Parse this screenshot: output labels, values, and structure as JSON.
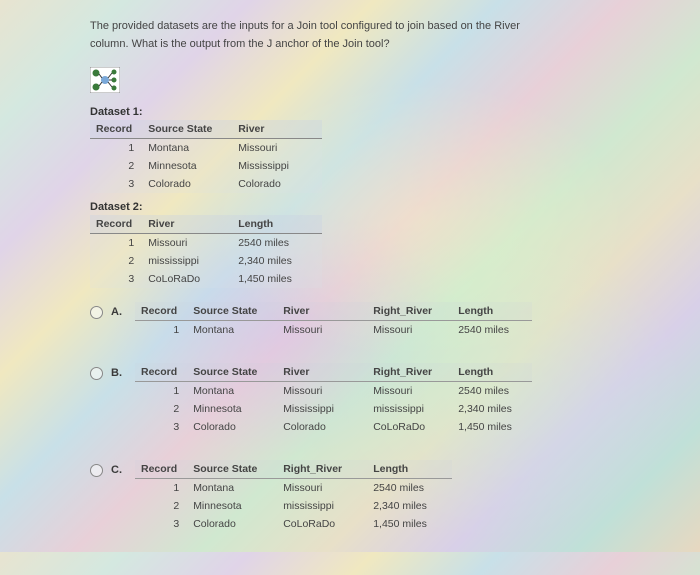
{
  "question": {
    "line1": "The provided datasets are the inputs for a Join tool configured to join based on the River",
    "line2": "column. What is the output from the J anchor of the Join tool?"
  },
  "dataset1": {
    "label": "Dataset 1:",
    "headers": {
      "h0": "Record",
      "h1": "Source State",
      "h2": "River"
    },
    "rows": [
      {
        "r": "1",
        "c1": "Montana",
        "c2": "Missouri"
      },
      {
        "r": "2",
        "c1": "Minnesota",
        "c2": "Mississippi"
      },
      {
        "r": "3",
        "c1": "Colorado",
        "c2": "Colorado"
      }
    ]
  },
  "dataset2": {
    "label": "Dataset 2:",
    "headers": {
      "h0": "Record",
      "h1": "River",
      "h2": "Length"
    },
    "rows": [
      {
        "r": "1",
        "c1": "Missouri",
        "c2": "2540 miles"
      },
      {
        "r": "2",
        "c1": "mississippi",
        "c2": "2,340 miles"
      },
      {
        "r": "3",
        "c1": "CoLoRaDo",
        "c2": "1,450 miles"
      }
    ]
  },
  "options": {
    "a": {
      "label": "A.",
      "headers": {
        "h0": "Record",
        "h1": "Source State",
        "h2": "River",
        "h3": "Right_River",
        "h4": "Length"
      },
      "rows": [
        {
          "r": "1",
          "c1": "Montana",
          "c2": "Missouri",
          "c3": "Missouri",
          "c4": "2540 miles"
        }
      ]
    },
    "b": {
      "label": "B.",
      "headers": {
        "h0": "Record",
        "h1": "Source State",
        "h2": "River",
        "h3": "Right_River",
        "h4": "Length"
      },
      "rows": [
        {
          "r": "1",
          "c1": "Montana",
          "c2": "Missouri",
          "c3": "Missouri",
          "c4": "2540 miles"
        },
        {
          "r": "2",
          "c1": "Minnesota",
          "c2": "Mississippi",
          "c3": "mississippi",
          "c4": "2,340 miles"
        },
        {
          "r": "3",
          "c1": "Colorado",
          "c2": "Colorado",
          "c3": "CoLoRaDo",
          "c4": "1,450 miles"
        }
      ]
    },
    "c": {
      "label": "C.",
      "headers": {
        "h0": "Record",
        "h1": "Source State",
        "h2": "Right_River",
        "h3": "Length"
      },
      "rows": [
        {
          "r": "1",
          "c1": "Montana",
          "c2": "Missouri",
          "c3": "2540 miles"
        },
        {
          "r": "2",
          "c1": "Minnesota",
          "c2": "mississippi",
          "c3": "2,340 miles"
        },
        {
          "r": "3",
          "c1": "Colorado",
          "c2": "CoLoRaDo",
          "c3": "1,450 miles"
        }
      ]
    }
  }
}
